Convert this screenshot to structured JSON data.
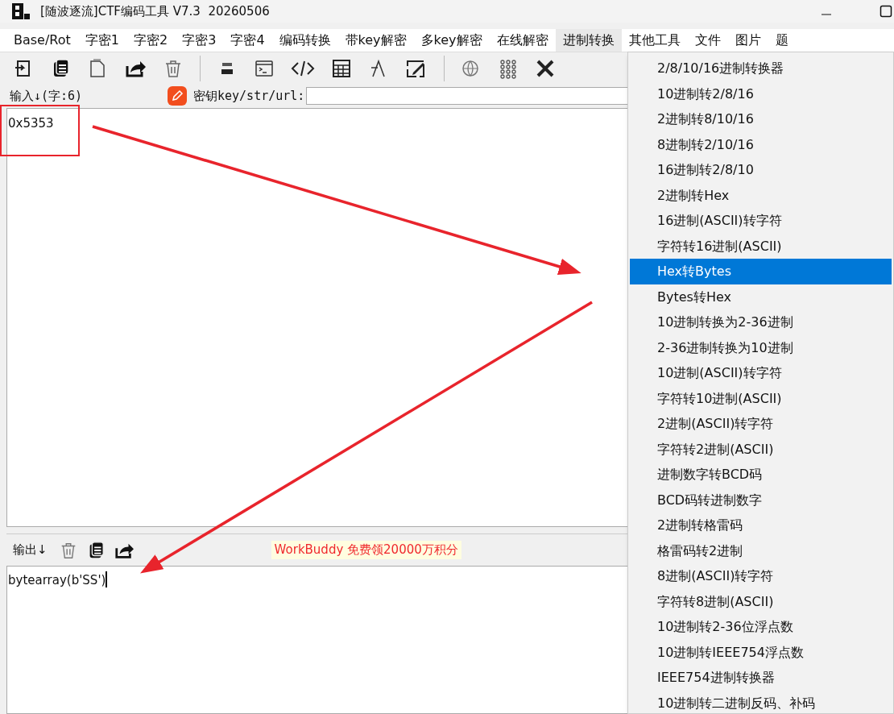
{
  "window": {
    "title": "[随波逐流]CTF编码工具 V7.3  20260506"
  },
  "menu_bar": [
    {
      "label": "Base/Rot",
      "selected": false
    },
    {
      "label": "字密1",
      "selected": false
    },
    {
      "label": "字密2",
      "selected": false
    },
    {
      "label": "字密3",
      "selected": false
    },
    {
      "label": "字密4",
      "selected": false
    },
    {
      "label": "编码转换",
      "selected": false
    },
    {
      "label": "带key解密",
      "selected": false
    },
    {
      "label": "多key解密",
      "selected": false
    },
    {
      "label": "在线解密",
      "selected": false
    },
    {
      "label": "进制转换",
      "selected": true
    },
    {
      "label": "其他工具",
      "selected": false
    },
    {
      "label": "文件",
      "selected": false
    },
    {
      "label": "图片",
      "selected": false
    },
    {
      "label": "题",
      "selected": false
    }
  ],
  "input": {
    "label": "输入↓(字:6)",
    "key_label": "密钥key/str/url:",
    "value": "0x5353"
  },
  "output": {
    "label": "输出↓",
    "banner": "WorkBuddy 免费领20000万积分",
    "value": "bytearray(b'SS')"
  },
  "dropdown_menu": [
    {
      "label": "2/8/10/16进制转换器",
      "selected": false
    },
    {
      "label": "10进制转2/8/16",
      "selected": false
    },
    {
      "label": "2进制转8/10/16",
      "selected": false
    },
    {
      "label": "8进制转2/10/16",
      "selected": false
    },
    {
      "label": "16进制转2/8/10",
      "selected": false
    },
    {
      "label": "2进制转Hex",
      "selected": false
    },
    {
      "label": "16进制(ASCII)转字符",
      "selected": false
    },
    {
      "label": "字符转16进制(ASCII)",
      "selected": false
    },
    {
      "label": "Hex转Bytes",
      "selected": true
    },
    {
      "label": "Bytes转Hex",
      "selected": false
    },
    {
      "label": "10进制转换为2-36进制",
      "selected": false
    },
    {
      "label": "2-36进制转换为10进制",
      "selected": false
    },
    {
      "label": "10进制(ASCII)转字符",
      "selected": false
    },
    {
      "label": "字符转10进制(ASCII)",
      "selected": false
    },
    {
      "label": "2进制(ASCII)转字符",
      "selected": false
    },
    {
      "label": "字符转2进制(ASCII)",
      "selected": false
    },
    {
      "label": "进制数字转BCD码",
      "selected": false
    },
    {
      "label": "BCD码转进制数字",
      "selected": false
    },
    {
      "label": "2进制转格雷码",
      "selected": false
    },
    {
      "label": "格雷码转2进制",
      "selected": false
    },
    {
      "label": "8进制(ASCII)转字符",
      "selected": false
    },
    {
      "label": "字符转8进制(ASCII)",
      "selected": false
    },
    {
      "label": "10进制转2-36位浮点数",
      "selected": false
    },
    {
      "label": "10进制转IEEE754浮点数",
      "selected": false
    },
    {
      "label": "IEEE754进制转换器",
      "selected": false
    },
    {
      "label": "10进制转二进制反码、补码",
      "selected": false
    }
  ]
}
